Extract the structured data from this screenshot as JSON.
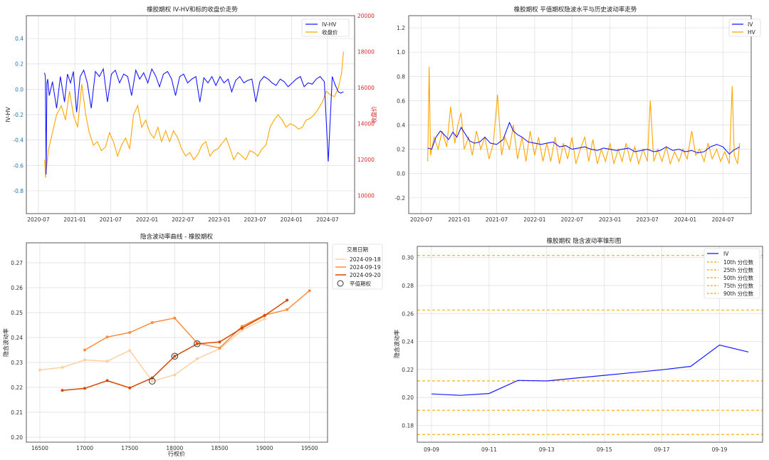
{
  "colors": {
    "blue": "#1a1aff",
    "orange": "#ffa500",
    "red": "#d62728",
    "c18": "#fdd0a2",
    "c19": "#fd8d3c",
    "c20": "#d94801"
  },
  "chart_data": [
    {
      "type": "line",
      "title": "橡胶期权 IV-HV和标的收盘价走势",
      "ylabel": "IV-HV",
      "y2label": "收盘价",
      "ylim": [
        -0.98,
        0.58
      ],
      "y2lim": [
        9000,
        20000
      ],
      "yticks": [
        "0.4",
        "0.2",
        "0.0",
        "-0.2",
        "-0.4",
        "-0.6",
        "-0.8"
      ],
      "y2ticks": [
        "20000",
        "18000",
        "16000",
        "14000",
        "12000",
        "10000"
      ],
      "xticks": [
        "2020-07",
        "2021-01",
        "2021-07",
        "2022-01",
        "2022-07",
        "2023-01",
        "2023-07",
        "2024-01",
        "2024-07"
      ],
      "xlim": [
        "2020-05-01",
        "2024-11-15"
      ],
      "legend": [
        "IV-HV",
        "收盘价"
      ],
      "series": [
        {
          "name": "IV-HV",
          "axis": "left",
          "x": [
            "2020-08-01",
            "2020-08-05",
            "2020-08-09",
            "2020-08-13",
            "2020-08-17",
            "2020-08-25",
            "2020-09-10",
            "2020-10-01",
            "2020-10-20",
            "2020-11-10",
            "2020-11-25",
            "2020-12-10",
            "2020-12-25",
            "2021-01-10",
            "2021-01-28",
            "2021-02-15",
            "2021-03-05",
            "2021-03-25",
            "2021-04-15",
            "2021-05-05",
            "2021-05-25",
            "2021-06-15",
            "2021-07-05",
            "2021-07-25",
            "2021-08-15",
            "2021-09-05",
            "2021-09-25",
            "2021-10-15",
            "2021-11-05",
            "2021-11-25",
            "2021-12-15",
            "2022-01-05",
            "2022-01-25",
            "2022-02-15",
            "2022-03-05",
            "2022-03-25",
            "2022-04-15",
            "2022-05-05",
            "2022-05-25",
            "2022-06-15",
            "2022-07-05",
            "2022-07-25",
            "2022-08-15",
            "2022-09-05",
            "2022-09-25",
            "2022-10-15",
            "2022-11-05",
            "2022-11-25",
            "2022-12-15",
            "2023-01-05",
            "2023-01-25",
            "2023-02-15",
            "2023-03-05",
            "2023-03-25",
            "2023-04-15",
            "2023-05-05",
            "2023-05-25",
            "2023-06-15",
            "2023-07-05",
            "2023-07-25",
            "2023-08-15",
            "2023-09-05",
            "2023-09-25",
            "2023-10-15",
            "2023-11-05",
            "2023-11-25",
            "2023-12-15",
            "2024-01-05",
            "2024-01-25",
            "2024-02-15",
            "2024-03-05",
            "2024-03-25",
            "2024-04-15",
            "2024-05-05",
            "2024-05-25",
            "2024-06-15",
            "2024-07-05",
            "2024-07-25",
            "2024-08-10",
            "2024-08-25",
            "2024-09-05",
            "2024-09-20"
          ],
          "y": [
            0.13,
            0.1,
            -0.67,
            0.05,
            0.08,
            -0.05,
            0.06,
            -0.15,
            0.1,
            -0.1,
            0.12,
            0.05,
            0.14,
            -0.18,
            0.1,
            0.15,
            0.05,
            -0.15,
            0.14,
            0.1,
            0.16,
            -0.1,
            0.12,
            0.15,
            0.05,
            0.12,
            0.1,
            -0.05,
            0.15,
            0.08,
            0.13,
            0.05,
            0.16,
            0.1,
            0.02,
            0.12,
            0.14,
            0.08,
            -0.05,
            0.1,
            0.12,
            0.05,
            0.08,
            0.1,
            -0.1,
            0.09,
            0.05,
            0.1,
            0.03,
            0.1,
            0.05,
            0.08,
            -0.02,
            0.07,
            0.1,
            0.05,
            0.07,
            0.08,
            -0.1,
            0.06,
            0.1,
            0.08,
            0.05,
            0.03,
            0.08,
            0.06,
            0.02,
            0.05,
            0.08,
            0.1,
            0.02,
            0.05,
            0.04,
            0.08,
            0.1,
            0.06,
            -0.57,
            0.1,
            0.03,
            -0.02,
            -0.03,
            -0.02
          ]
        },
        {
          "name": "收盘价",
          "axis": "right",
          "x": [
            "2020-08-01",
            "2020-08-06",
            "2020-08-20",
            "2020-09-10",
            "2020-10-01",
            "2020-10-25",
            "2020-11-15",
            "2020-12-05",
            "2020-12-25",
            "2021-01-15",
            "2021-02-05",
            "2021-02-25",
            "2021-03-15",
            "2021-04-05",
            "2021-04-25",
            "2021-05-15",
            "2021-06-05",
            "2021-06-25",
            "2021-07-15",
            "2021-08-05",
            "2021-08-25",
            "2021-09-15",
            "2021-10-05",
            "2021-10-25",
            "2021-11-15",
            "2021-12-05",
            "2021-12-25",
            "2022-01-15",
            "2022-02-05",
            "2022-02-25",
            "2022-03-15",
            "2022-04-05",
            "2022-04-25",
            "2022-05-15",
            "2022-06-05",
            "2022-06-25",
            "2022-07-15",
            "2022-08-05",
            "2022-08-25",
            "2022-09-15",
            "2022-10-05",
            "2022-10-25",
            "2022-11-15",
            "2022-12-05",
            "2022-12-25",
            "2023-01-15",
            "2023-02-05",
            "2023-02-25",
            "2023-03-15",
            "2023-04-05",
            "2023-04-25",
            "2023-05-15",
            "2023-06-05",
            "2023-06-25",
            "2023-07-15",
            "2023-08-05",
            "2023-08-25",
            "2023-09-15",
            "2023-10-05",
            "2023-10-25",
            "2023-11-15",
            "2023-12-05",
            "2023-12-25",
            "2024-01-15",
            "2024-02-05",
            "2024-02-25",
            "2024-03-15",
            "2024-04-05",
            "2024-04-25",
            "2024-05-15",
            "2024-06-05",
            "2024-06-25",
            "2024-07-15",
            "2024-08-05",
            "2024-08-25",
            "2024-09-10",
            "2024-09-20"
          ],
          "y": [
            12000,
            11000,
            12500,
            13500,
            14500,
            15000,
            14200,
            15800,
            14500,
            13800,
            16200,
            14500,
            13500,
            12800,
            13000,
            12500,
            12700,
            13500,
            13000,
            12200,
            12800,
            13200,
            12600,
            14500,
            15000,
            13800,
            14200,
            13500,
            13200,
            13800,
            13000,
            13600,
            13000,
            13600,
            13200,
            12600,
            12200,
            12400,
            12000,
            12300,
            12800,
            13000,
            12200,
            12500,
            12600,
            12900,
            13200,
            12600,
            12000,
            12400,
            12200,
            12000,
            12500,
            12400,
            12200,
            12600,
            12800,
            13800,
            14200,
            14500,
            14200,
            13800,
            14000,
            13900,
            13700,
            13800,
            14200,
            14300,
            14500,
            14800,
            15200,
            15800,
            15600,
            15500,
            16000,
            16800,
            18000
          ]
        }
      ]
    },
    {
      "type": "line",
      "title": "橡胶期权 平值期权隐波水平与历史波动率走势",
      "ylim": [
        -0.33,
        1.3
      ],
      "yticks": [
        "1.2",
        "1.0",
        "0.8",
        "0.6",
        "0.4",
        "0.2",
        "0.0",
        "-0.2"
      ],
      "xticks": [
        "2020-07",
        "2021-01",
        "2021-07",
        "2022-01",
        "2022-07",
        "2023-01",
        "2023-07",
        "2024-01",
        "2024-07"
      ],
      "xlim": [
        "2020-05-01",
        "2024-11-15"
      ],
      "legend": [
        "IV",
        "HV"
      ],
      "series": [
        {
          "name": "IV",
          "x": [
            "2020-08-01",
            "2020-08-20",
            "2020-09-10",
            "2020-10-01",
            "2020-10-20",
            "2020-11-10",
            "2020-12-01",
            "2020-12-20",
            "2021-01-10",
            "2021-02-01",
            "2021-02-20",
            "2021-03-15",
            "2021-04-10",
            "2021-05-05",
            "2021-06-01",
            "2021-07-01",
            "2021-08-01",
            "2021-09-01",
            "2021-09-20",
            "2021-10-10",
            "2021-11-01",
            "2021-12-01",
            "2022-01-01",
            "2022-02-01",
            "2022-03-01",
            "2022-04-01",
            "2022-05-01",
            "2022-06-01",
            "2022-07-01",
            "2022-08-01",
            "2022-09-01",
            "2022-10-01",
            "2022-11-01",
            "2022-12-01",
            "2023-01-01",
            "2023-02-01",
            "2023-03-01",
            "2023-04-01",
            "2023-05-01",
            "2023-06-01",
            "2023-07-01",
            "2023-08-01",
            "2023-09-01",
            "2023-10-01",
            "2023-11-01",
            "2023-12-01",
            "2024-01-01",
            "2024-02-01",
            "2024-03-01",
            "2024-04-01",
            "2024-05-01",
            "2024-06-01",
            "2024-07-01",
            "2024-08-01",
            "2024-08-20",
            "2024-09-20"
          ],
          "y": [
            0.21,
            0.2,
            0.3,
            0.35,
            0.32,
            0.28,
            0.34,
            0.3,
            0.38,
            0.32,
            0.27,
            0.25,
            0.26,
            0.3,
            0.25,
            0.24,
            0.28,
            0.42,
            0.35,
            0.32,
            0.3,
            0.26,
            0.25,
            0.24,
            0.25,
            0.26,
            0.22,
            0.23,
            0.2,
            0.21,
            0.22,
            0.2,
            0.19,
            0.21,
            0.2,
            0.19,
            0.2,
            0.21,
            0.18,
            0.19,
            0.2,
            0.18,
            0.19,
            0.22,
            0.19,
            0.2,
            0.18,
            0.19,
            0.17,
            0.18,
            0.22,
            0.24,
            0.22,
            0.16,
            0.19,
            0.22
          ]
        },
        {
          "name": "HV",
          "x": [
            "2020-08-01",
            "2020-08-08",
            "2020-08-15",
            "2020-09-01",
            "2020-09-20",
            "2020-10-10",
            "2020-11-01",
            "2020-11-20",
            "2020-12-10",
            "2020-12-25",
            "2021-01-10",
            "2021-01-25",
            "2021-02-15",
            "2021-03-05",
            "2021-03-25",
            "2021-04-15",
            "2021-05-05",
            "2021-05-25",
            "2021-06-15",
            "2021-07-05",
            "2021-07-25",
            "2021-08-10",
            "2021-09-01",
            "2021-09-20",
            "2021-10-10",
            "2021-11-01",
            "2021-11-20",
            "2021-12-10",
            "2022-01-01",
            "2022-01-20",
            "2022-02-10",
            "2022-03-01",
            "2022-03-20",
            "2022-04-10",
            "2022-05-01",
            "2022-05-20",
            "2022-06-10",
            "2022-07-01",
            "2022-07-20",
            "2022-08-10",
            "2022-09-01",
            "2022-09-20",
            "2022-10-10",
            "2022-11-01",
            "2022-11-20",
            "2022-12-10",
            "2023-01-01",
            "2023-01-20",
            "2023-02-10",
            "2023-03-01",
            "2023-03-20",
            "2023-04-10",
            "2023-05-01",
            "2023-05-20",
            "2023-06-10",
            "2023-07-01",
            "2023-07-15",
            "2023-08-01",
            "2023-08-20",
            "2023-09-10",
            "2023-10-01",
            "2023-10-20",
            "2023-11-10",
            "2023-12-01",
            "2023-12-20",
            "2024-01-10",
            "2024-02-01",
            "2024-02-20",
            "2024-03-10",
            "2024-04-01",
            "2024-04-20",
            "2024-05-10",
            "2024-06-01",
            "2024-06-20",
            "2024-07-10",
            "2024-08-01",
            "2024-08-15",
            "2024-08-25",
            "2024-09-10",
            "2024-09-20"
          ],
          "y": [
            0.1,
            0.88,
            0.15,
            0.3,
            0.2,
            0.35,
            0.22,
            0.55,
            0.25,
            0.4,
            0.5,
            0.2,
            0.3,
            0.15,
            0.35,
            0.2,
            0.3,
            0.12,
            0.25,
            0.65,
            0.15,
            0.3,
            0.2,
            0.4,
            0.12,
            0.3,
            0.1,
            0.35,
            0.15,
            0.3,
            0.1,
            0.25,
            0.1,
            0.3,
            0.08,
            0.25,
            0.12,
            0.3,
            0.08,
            0.2,
            0.3,
            0.1,
            0.28,
            0.08,
            0.2,
            0.1,
            0.25,
            0.08,
            0.2,
            0.1,
            0.25,
            0.1,
            0.22,
            0.08,
            0.2,
            0.1,
            0.6,
            0.1,
            0.2,
            0.1,
            0.22,
            0.08,
            0.18,
            0.1,
            0.2,
            0.12,
            0.35,
            0.15,
            0.2,
            0.1,
            0.25,
            0.12,
            0.2,
            0.1,
            0.18,
            0.08,
            0.72,
            0.15,
            0.08,
            0.25
          ]
        }
      ]
    },
    {
      "type": "line",
      "title": "隐含波动率曲线 - 橡胶期权",
      "xlabel": "行权价",
      "ylabel": "隐含波动率",
      "xlim": [
        16350,
        19700
      ],
      "ylim": [
        0.198,
        0.278
      ],
      "xticks": [
        16500,
        17000,
        17500,
        18000,
        18500,
        19000,
        19500
      ],
      "yticks": [
        "0.27",
        "0.26",
        "0.25",
        "0.24",
        "0.23",
        "0.22",
        "0.21",
        "0.20"
      ],
      "legend_title": "交易日期",
      "legend": [
        "2024-09-18",
        "2024-09-19",
        "2024-09-20",
        "平值期权"
      ],
      "series": [
        {
          "name": "2024-09-18",
          "x": [
            16500,
            16750,
            17000,
            17250,
            17500,
            17750,
            18000,
            18250,
            18500,
            18750,
            19000
          ],
          "y": [
            0.227,
            0.228,
            0.231,
            0.2305,
            0.2348,
            0.2225,
            0.225,
            0.2315,
            0.2355,
            0.243,
            0.2475
          ]
        },
        {
          "name": "2024-09-19",
          "x": [
            17000,
            17250,
            17500,
            17750,
            18000,
            18250,
            18500,
            18750,
            19000,
            19250,
            19500
          ],
          "y": [
            0.235,
            0.2402,
            0.242,
            0.246,
            0.2478,
            0.2378,
            0.2358,
            0.2445,
            0.249,
            0.2512,
            0.2588
          ]
        },
        {
          "name": "2024-09-20",
          "x": [
            16750,
            17000,
            17250,
            17500,
            17750,
            18000,
            18250,
            18500,
            18750,
            19000,
            19250
          ],
          "y": [
            0.2188,
            0.2196,
            0.2227,
            0.2198,
            0.2238,
            0.2325,
            0.2375,
            0.2382,
            0.2438,
            0.2488,
            0.255
          ]
        }
      ],
      "atm_points": [
        {
          "x": 17750,
          "y": 0.2225
        },
        {
          "x": 18000,
          "y": 0.2325
        },
        {
          "x": 18250,
          "y": 0.2375
        }
      ]
    },
    {
      "type": "line",
      "title": "橡胶期权 隐含波动率锥形图",
      "ylabel": "隐含波动率",
      "ylim": [
        0.168,
        0.308
      ],
      "yticks": [
        "0.30",
        "0.28",
        "0.26",
        "0.24",
        "0.22",
        "0.20",
        "0.18"
      ],
      "xticks": [
        "09-09",
        "09-11",
        "09-13",
        "09-15",
        "09-17",
        "09-19"
      ],
      "x": [
        "09-09",
        "09-10",
        "09-11",
        "09-12",
        "09-13",
        "09-14",
        "09-15",
        "09-16",
        "09-17",
        "09-18",
        "09-19",
        "09-20"
      ],
      "legend": [
        "IV",
        "10th 分位数",
        "25th 分位数",
        "50th 分位数",
        "75th 分位数",
        "90th 分位数"
      ],
      "series": [
        {
          "name": "IV",
          "y": [
            0.2025,
            0.2015,
            0.2028,
            0.2122,
            0.2118,
            0.2138,
            0.2158,
            0.2178,
            0.2198,
            0.2222,
            0.2375,
            0.2325
          ]
        }
      ],
      "quantiles": [
        0.1735,
        0.1908,
        0.2118,
        0.2625,
        0.3015
      ]
    }
  ]
}
